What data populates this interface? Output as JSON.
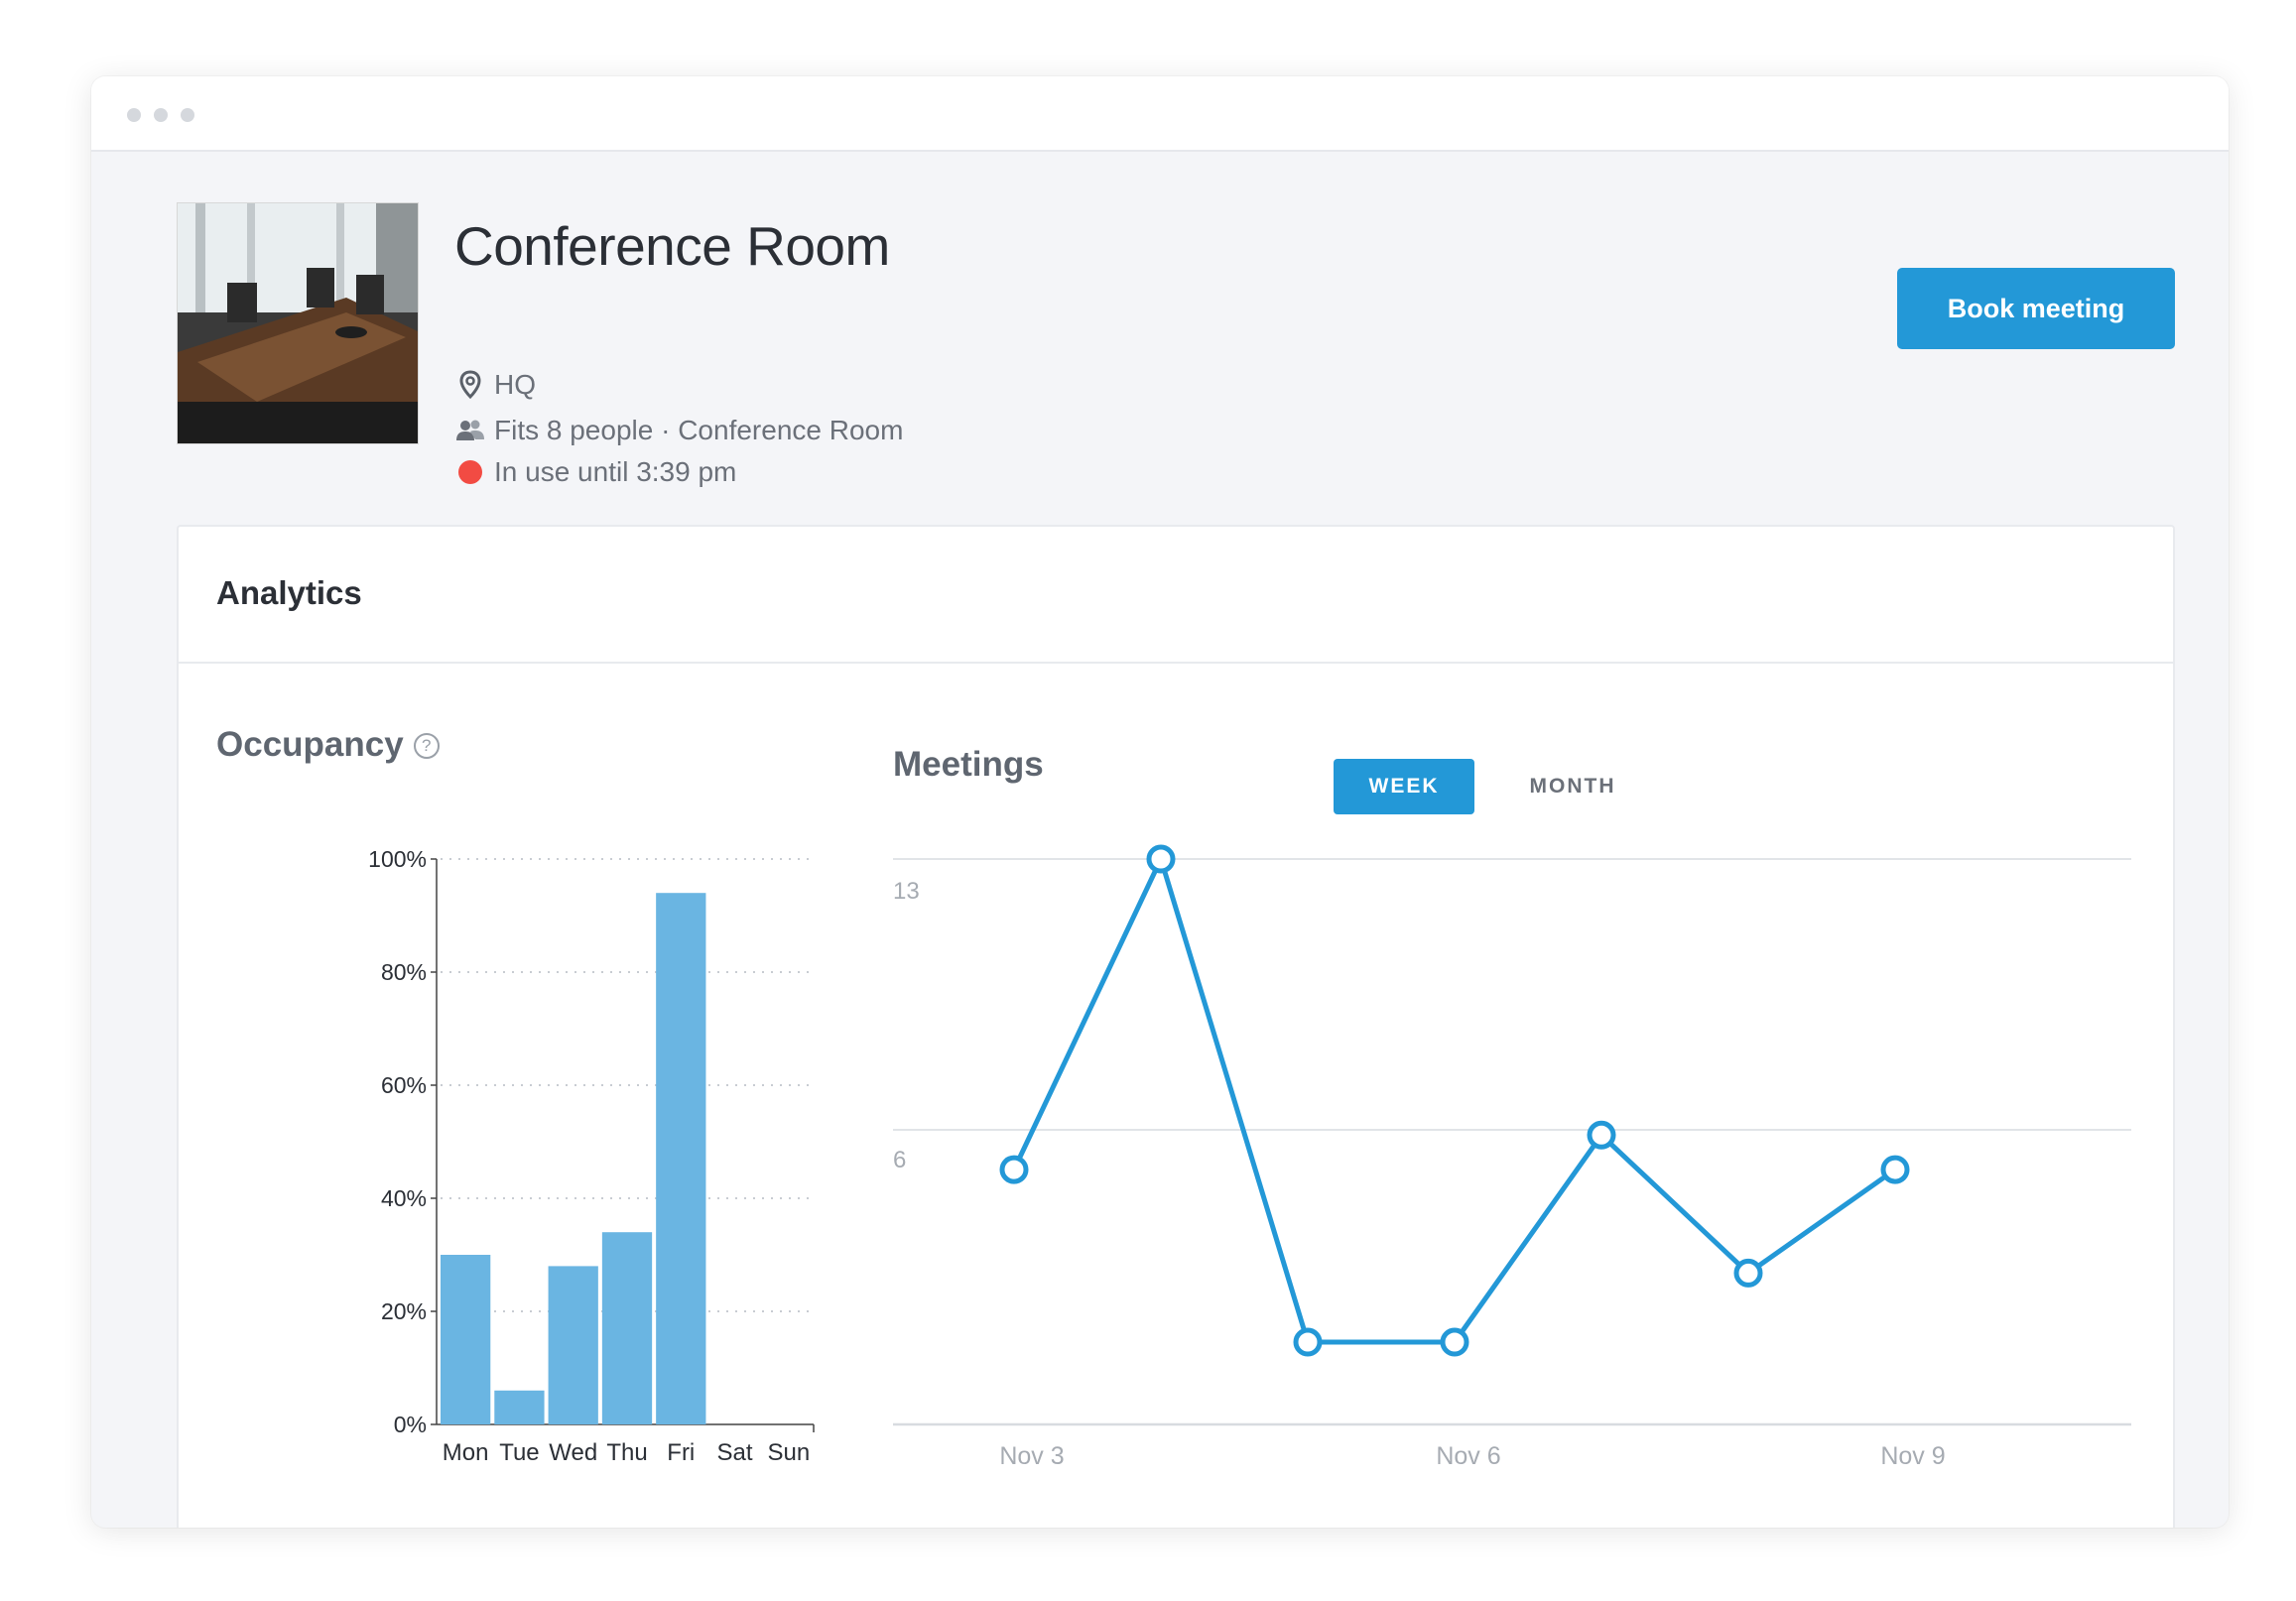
{
  "room": {
    "name": "Conference Room",
    "location": "HQ",
    "capacity": "Fits 8 people · Conference Room",
    "status": "In use until 3:39 pm"
  },
  "actions": {
    "book_label": "Book meeting"
  },
  "analytics": {
    "title": "Analytics",
    "occupancy_title": "Occupancy",
    "help_symbol": "?",
    "meetings_title": "Meetings",
    "tabs": [
      {
        "label": "WEEK",
        "active": true
      },
      {
        "label": "MONTH",
        "active": false
      }
    ]
  },
  "colors": {
    "accent": "#2398d7",
    "bar": "#6ab5e2",
    "status": "#f24b43"
  },
  "icons": {
    "location": "map-pin-icon",
    "capacity": "people-icon",
    "status": "status-dot-icon",
    "help": "help-circle-icon"
  },
  "chart_data": [
    {
      "type": "bar",
      "categories": [
        "Mon",
        "Tue",
        "Wed",
        "Thu",
        "Fri",
        "Sat",
        "Sun"
      ],
      "values": [
        30,
        6,
        28,
        34,
        94,
        0,
        0
      ],
      "yticks": [
        "0%",
        "20%",
        "40%",
        "60%",
        "80%",
        "100%"
      ],
      "ylim": [
        0,
        100
      ],
      "grid": true
    },
    {
      "type": "line",
      "x": [
        "Nov 3",
        "Nov 4",
        "Nov 5",
        "Nov 6",
        "Nov 7",
        "Nov 8",
        "Nov 9"
      ],
      "values": [
        5,
        14,
        0,
        0,
        6,
        2,
        5
      ],
      "xticks": [
        "Nov 3",
        "Nov 6",
        "Nov 9"
      ],
      "yticks": [
        "6",
        "13"
      ],
      "grid": true
    }
  ]
}
